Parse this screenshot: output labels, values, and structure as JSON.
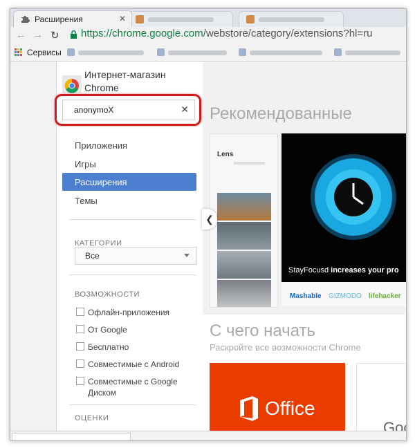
{
  "tabs": [
    {
      "label": "Расширения",
      "active": true
    },
    {
      "label": "",
      "active": false
    },
    {
      "label": "",
      "active": false
    }
  ],
  "address": {
    "secure_part": "https://chrome.google.com",
    "path": "/webstore/category/extensions?hl=ru"
  },
  "bookmarks": {
    "apps_label": "Сервисы"
  },
  "store": {
    "title": "Интернет-магазин Chrome",
    "search_value": "anonymoX",
    "nav": [
      "Приложения",
      "Игры",
      "Расширения",
      "Темы"
    ],
    "active_nav": "Расширения",
    "categories_label": "КАТЕГОРИИ",
    "category_value": "Все",
    "features_label": "ВОЗМОЖНОСТИ",
    "features": [
      "Офлайн-приложения",
      "От Google",
      "Бесплатно",
      "Совместимые с Android",
      "Совместимые с Google Диском"
    ],
    "ratings_label": "ОЦЕНКИ",
    "stars": "★★★★★"
  },
  "main": {
    "featured_title": "Рекомендованные",
    "lens_title": "Lens",
    "banner_caption_1": "StayFocusd",
    "banner_caption_2": "increases your pro",
    "press": [
      "Mashable",
      "GIZMODO",
      "lifehacker"
    ],
    "start_title": "С чего начать",
    "start_sub": "Раскройте все возможности Chrome",
    "office_label": "Office",
    "google_label": "Goo"
  },
  "colors": {
    "accent": "#4d7fd1",
    "highlight_ring": "#cf1b1b",
    "office": "#eb3c00",
    "secure": "#0b8043"
  }
}
